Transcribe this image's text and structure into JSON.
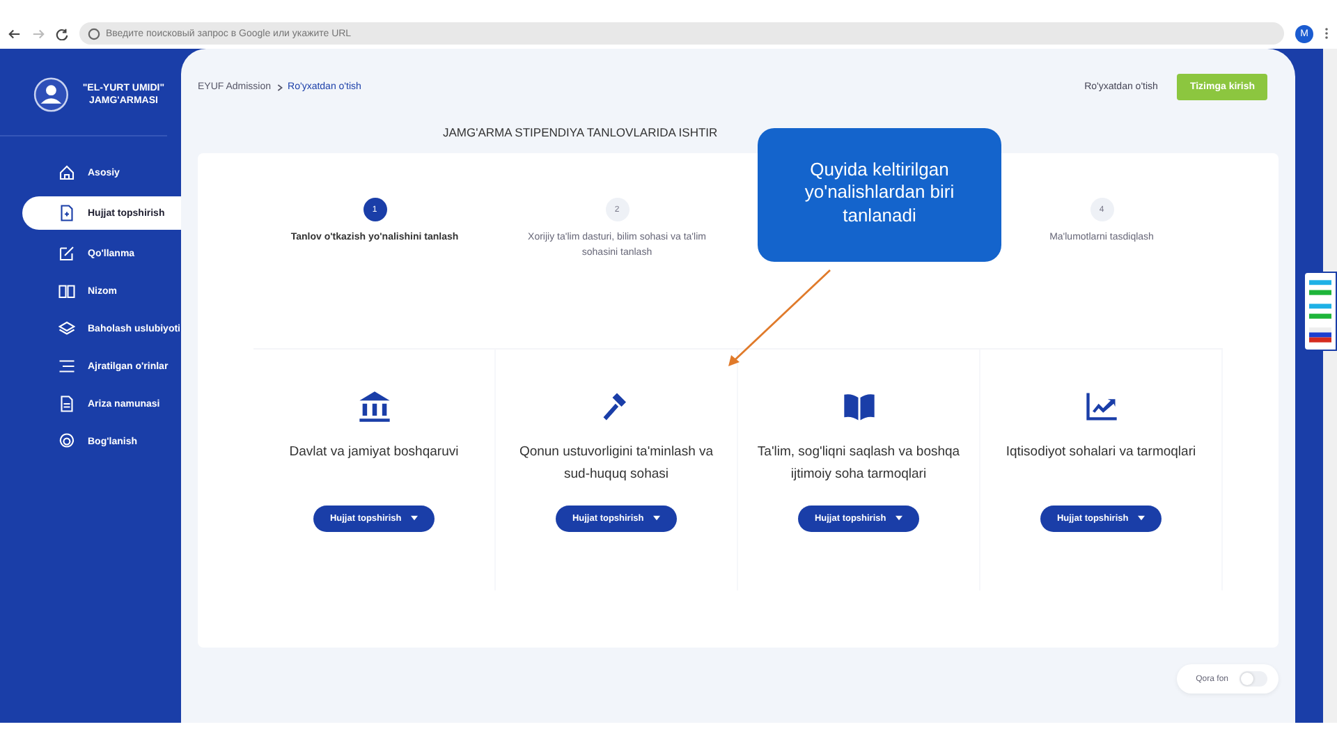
{
  "browser": {
    "address_placeholder": "Введите поисковый запрос в Google или укажите URL",
    "profile": "M"
  },
  "sidebar": {
    "logo_text": "\"EL-YURT UMIDI\" JAMG'ARMASI",
    "items": [
      {
        "label": "Asosiy",
        "selected": false
      },
      {
        "label": "Hujjat topshirish",
        "selected": true
      },
      {
        "label": "Qo'llanma",
        "selected": false
      },
      {
        "label": "Nizom",
        "selected": false
      },
      {
        "label": "Baholash uslubiyoti",
        "selected": false
      },
      {
        "label": "Ajratilgan o'rinlar",
        "selected": false
      },
      {
        "label": "Ariza namunasi",
        "selected": false
      },
      {
        "label": "Bog'lanish",
        "selected": false
      }
    ]
  },
  "breadcrumb": [
    "EYUF Admission",
    "Ro'yxatdan o'tish"
  ],
  "header": {
    "register_link": "Ro'yxatdan o'tish",
    "login_button": "Tizimga kirish"
  },
  "page_title": "JAMG'ARMA STIPENDIYA TANLOVLARIDA ISHTIR",
  "steps": [
    {
      "number": "1",
      "label": "Tanlov o'tkazish yo'nalishini tanlash",
      "selected": true
    },
    {
      "number": "2",
      "label": "Xorijiy ta'lim dasturi, bilim sohasi va ta'lim sohasini tanlash",
      "selected": false
    },
    {
      "number": "4",
      "label": "Ma'lumotlarni tasdiqlash",
      "selected": false
    }
  ],
  "callout": "Quyida keltirilgan yo'nalishlardan biri tanlanadi",
  "directions": [
    {
      "title": "Davlat va jamiyat boshqaruvi",
      "button": "Hujjat topshirish"
    },
    {
      "title": "Qonun ustuvorligini ta'minlash va sud-huquq sohasi",
      "button": "Hujjat topshirish"
    },
    {
      "title": "Ta'lim, sog'liqni saqlash va boshqa ijtimoiy soha tarmoqlari",
      "button": "Hujjat topshirish"
    },
    {
      "title": "Iqtisodiyot sohalari va tarmoqlari",
      "button": "Hujjat topshirish"
    }
  ],
  "dark_mode": {
    "label": "Qora fon",
    "on": false
  }
}
